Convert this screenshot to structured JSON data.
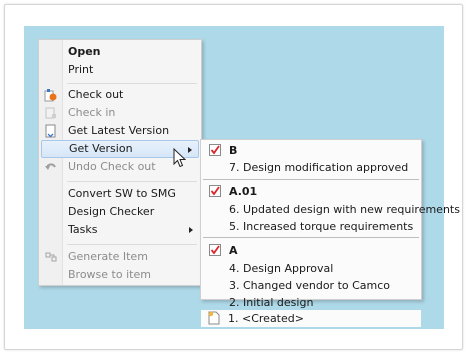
{
  "context_menu": {
    "items": [
      {
        "label": "Open"
      },
      {
        "label": "Print"
      },
      {
        "label": "Check out"
      },
      {
        "label": "Check in"
      },
      {
        "label": "Get Latest Version"
      },
      {
        "label": "Get Version"
      },
      {
        "label": "Undo Check out"
      },
      {
        "label": "Convert SW to SMG"
      },
      {
        "label": "Design Checker"
      },
      {
        "label": "Tasks"
      },
      {
        "label": "Generate Item"
      },
      {
        "label": "Browse to item"
      }
    ]
  },
  "version_submenu": {
    "groups": [
      {
        "revision": "B",
        "versions": [
          "7. Design modification approved"
        ]
      },
      {
        "revision": "A.01",
        "versions": [
          "6. Updated design with new requirements",
          "5. Increased torque requirements"
        ]
      },
      {
        "revision": "A",
        "versions": [
          "4. Design Approval",
          "3. Changed vendor to Camco",
          "2. Initial design",
          "1. <Created>"
        ]
      }
    ]
  },
  "colors": {
    "background": "#aed9e8",
    "highlight": "#d6e6f8",
    "check": "#d9262c"
  }
}
